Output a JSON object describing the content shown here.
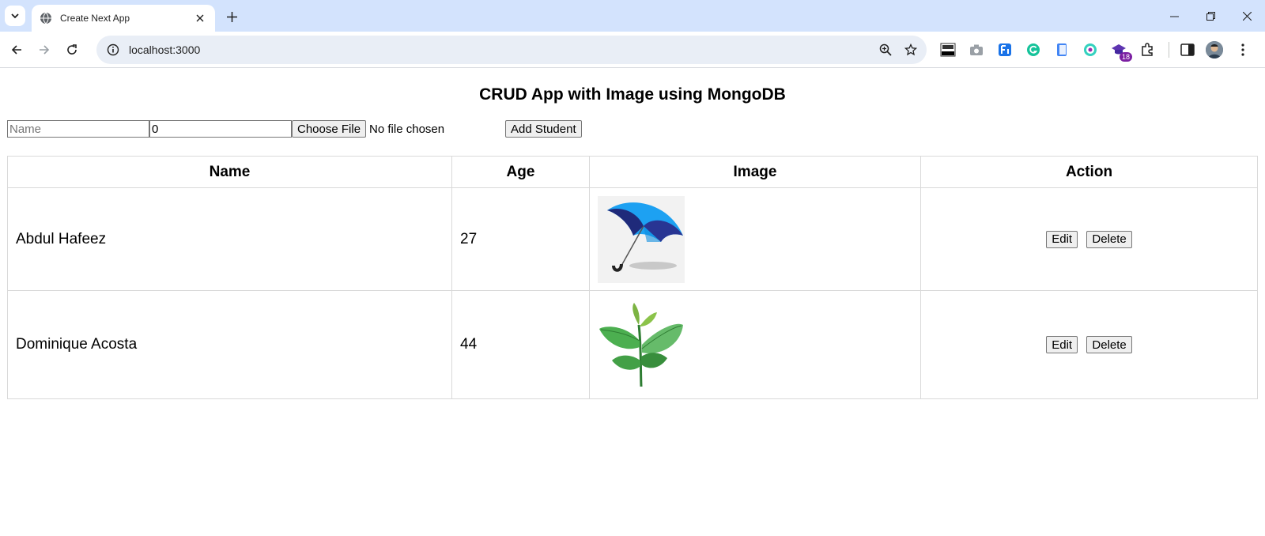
{
  "browser": {
    "tab_title": "Create Next App",
    "url": "localhost:3000",
    "extension_badge": "18"
  },
  "page": {
    "title": "CRUD App with Image using MongoDB"
  },
  "form": {
    "name_placeholder": "Name",
    "age_value": "0",
    "choose_file_label": "Choose File",
    "no_file_text": "No file chosen",
    "add_button_label": "Add Student"
  },
  "table": {
    "headers": [
      "Name",
      "Age",
      "Image",
      "Action"
    ],
    "rows": [
      {
        "name": "Abdul Hafeez",
        "age": "27",
        "image": "umbrella-image",
        "edit_label": "Edit",
        "delete_label": "Delete"
      },
      {
        "name": "Dominique Acosta",
        "age": "44",
        "image": "tea-leaf-image",
        "edit_label": "Edit",
        "delete_label": "Delete"
      }
    ]
  },
  "colors": {
    "tabstrip": "#d3e3fd",
    "omnibox": "#e9eef6",
    "table_border": "#d9d9d9"
  }
}
